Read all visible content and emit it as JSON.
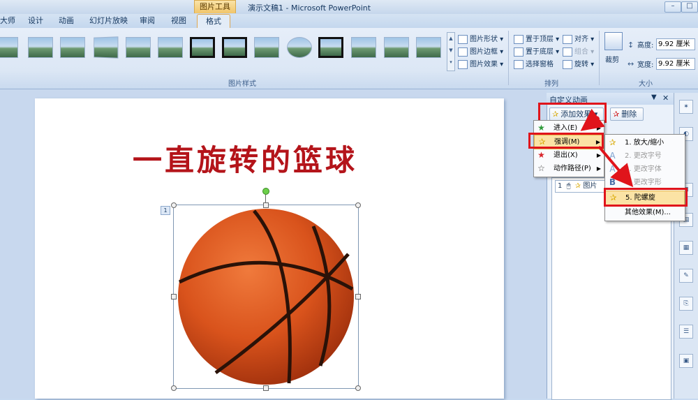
{
  "window": {
    "title": "演示文稿1 - Microsoft PowerPoint",
    "tool_tab_label": "图片工具",
    "minimize_glyph": "–",
    "maximize_glyph": "□"
  },
  "tabs": [
    "大师",
    "设计",
    "动画",
    "幻灯片放映",
    "审阅",
    "视图"
  ],
  "active_tab": "格式",
  "ribbon": {
    "picture_styles_label": "图片样式",
    "picture_shape": "图片形状",
    "picture_border": "图片边框",
    "picture_effects": "图片效果",
    "bring_to_front": "置于顶层",
    "send_to_back": "置于底层",
    "selection_pane": "选择窗格",
    "align": "对齐",
    "group": "组合",
    "rotate": "旋转",
    "arrange_label": "排列",
    "crop": "裁剪",
    "height_label": "高度:",
    "height_value": "9.92 厘米",
    "width_label": "宽度:",
    "width_value": "9.92 厘米",
    "size_label": "大小"
  },
  "slide": {
    "title": "一直旋转的篮球",
    "animation_tag": "1"
  },
  "pane": {
    "title": "自定义动画",
    "add_effect": "添加效果",
    "remove": "删除",
    "list_item_index": "1",
    "list_item_label": "图片"
  },
  "add_effect_menu": [
    {
      "label": "进入(E)",
      "icon": "star-green"
    },
    {
      "label": "强调(M)",
      "icon": "star-yellow",
      "highlighted": true
    },
    {
      "label": "退出(X)",
      "icon": "star-red"
    },
    {
      "label": "动作路径(P)",
      "icon": "star-outline"
    }
  ],
  "emphasis_menu": [
    {
      "label": "1. 放大/缩小",
      "enabled": true
    },
    {
      "label": "2. 更改字号",
      "enabled": false
    },
    {
      "label": "3. 更改字体",
      "enabled": false
    },
    {
      "label": "4. 更改字形",
      "enabled": false
    },
    {
      "label": "5. 陀螺旋",
      "enabled": true,
      "highlighted": true
    },
    {
      "label": "其他效果(M)...",
      "enabled": true
    }
  ],
  "colors": {
    "highlight_red": "#e0141b",
    "title_red": "#b4141a",
    "menu_highlight": "#fbe3a5",
    "ribbon_blue": "#dce7f5"
  }
}
